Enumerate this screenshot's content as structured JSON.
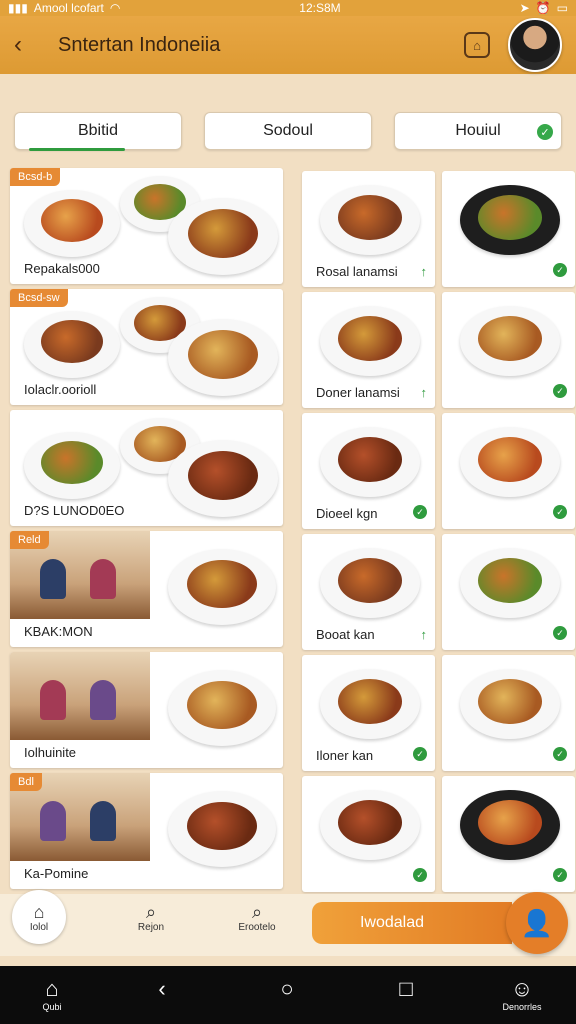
{
  "status": {
    "carrier": "Amool lcofart",
    "time": "12:S8M",
    "icons": [
      "signal-icon",
      "wifi-icon",
      "location-icon",
      "alarm-icon",
      "battery-icon"
    ]
  },
  "header": {
    "title": "Sntertan Indoneiia",
    "back_icon": "chevron-left-icon",
    "action_icon": "bag-icon"
  },
  "tabs": [
    {
      "label": "Bbitid",
      "active": true,
      "checked": false
    },
    {
      "label": "Sodoul",
      "active": false,
      "checked": false
    },
    {
      "label": "Houiul",
      "active": false,
      "checked": true
    }
  ],
  "wide_cards": [
    {
      "tag": "Bcsd-b",
      "label": "Repakals000",
      "type": "food"
    },
    {
      "tag": "Bcsd-sw",
      "label": "Iolaclr.oorioll",
      "type": "food"
    },
    {
      "tag": "",
      "label": "D?S LUNOD0EO",
      "type": "food"
    },
    {
      "tag": "Reld",
      "label": "KBAK:MON",
      "type": "people"
    },
    {
      "tag": "",
      "label": "Iolhuinite",
      "type": "people"
    },
    {
      "tag": "Bdl",
      "label": "Ka-Pomine",
      "type": "people"
    }
  ],
  "cards": [
    {
      "label": "Rosal lanamsi",
      "mark": "arrow"
    },
    {
      "label": "",
      "mark": "check"
    },
    {
      "label": "Doner lanamsi",
      "mark": "arrow"
    },
    {
      "label": "",
      "mark": "check"
    },
    {
      "label": "Dioeel kgn",
      "mark": "check"
    },
    {
      "label": "",
      "mark": "check"
    },
    {
      "label": "Booat kan",
      "mark": "arrow"
    },
    {
      "label": "",
      "mark": "check"
    },
    {
      "label": "Iloner kan",
      "mark": "check"
    },
    {
      "label": "",
      "mark": "check"
    },
    {
      "label": "",
      "mark": "check"
    },
    {
      "label": "",
      "mark": "check"
    }
  ],
  "bottom": {
    "items": [
      {
        "label": "Iolol",
        "icon": "home-icon"
      },
      {
        "label": "Rejon",
        "icon": "search-icon"
      },
      {
        "label": "Erootelo",
        "icon": "search-icon"
      }
    ],
    "cta": "Iwodalad",
    "cta_icon": "user-icon"
  },
  "sysnav": [
    {
      "label": "Qubi",
      "icon": "home-icon"
    },
    {
      "label": "",
      "icon": "back-icon"
    },
    {
      "label": "",
      "icon": "circle-icon"
    },
    {
      "label": "",
      "icon": "square-icon"
    },
    {
      "label": "Denorrles",
      "icon": "user-icon"
    }
  ]
}
